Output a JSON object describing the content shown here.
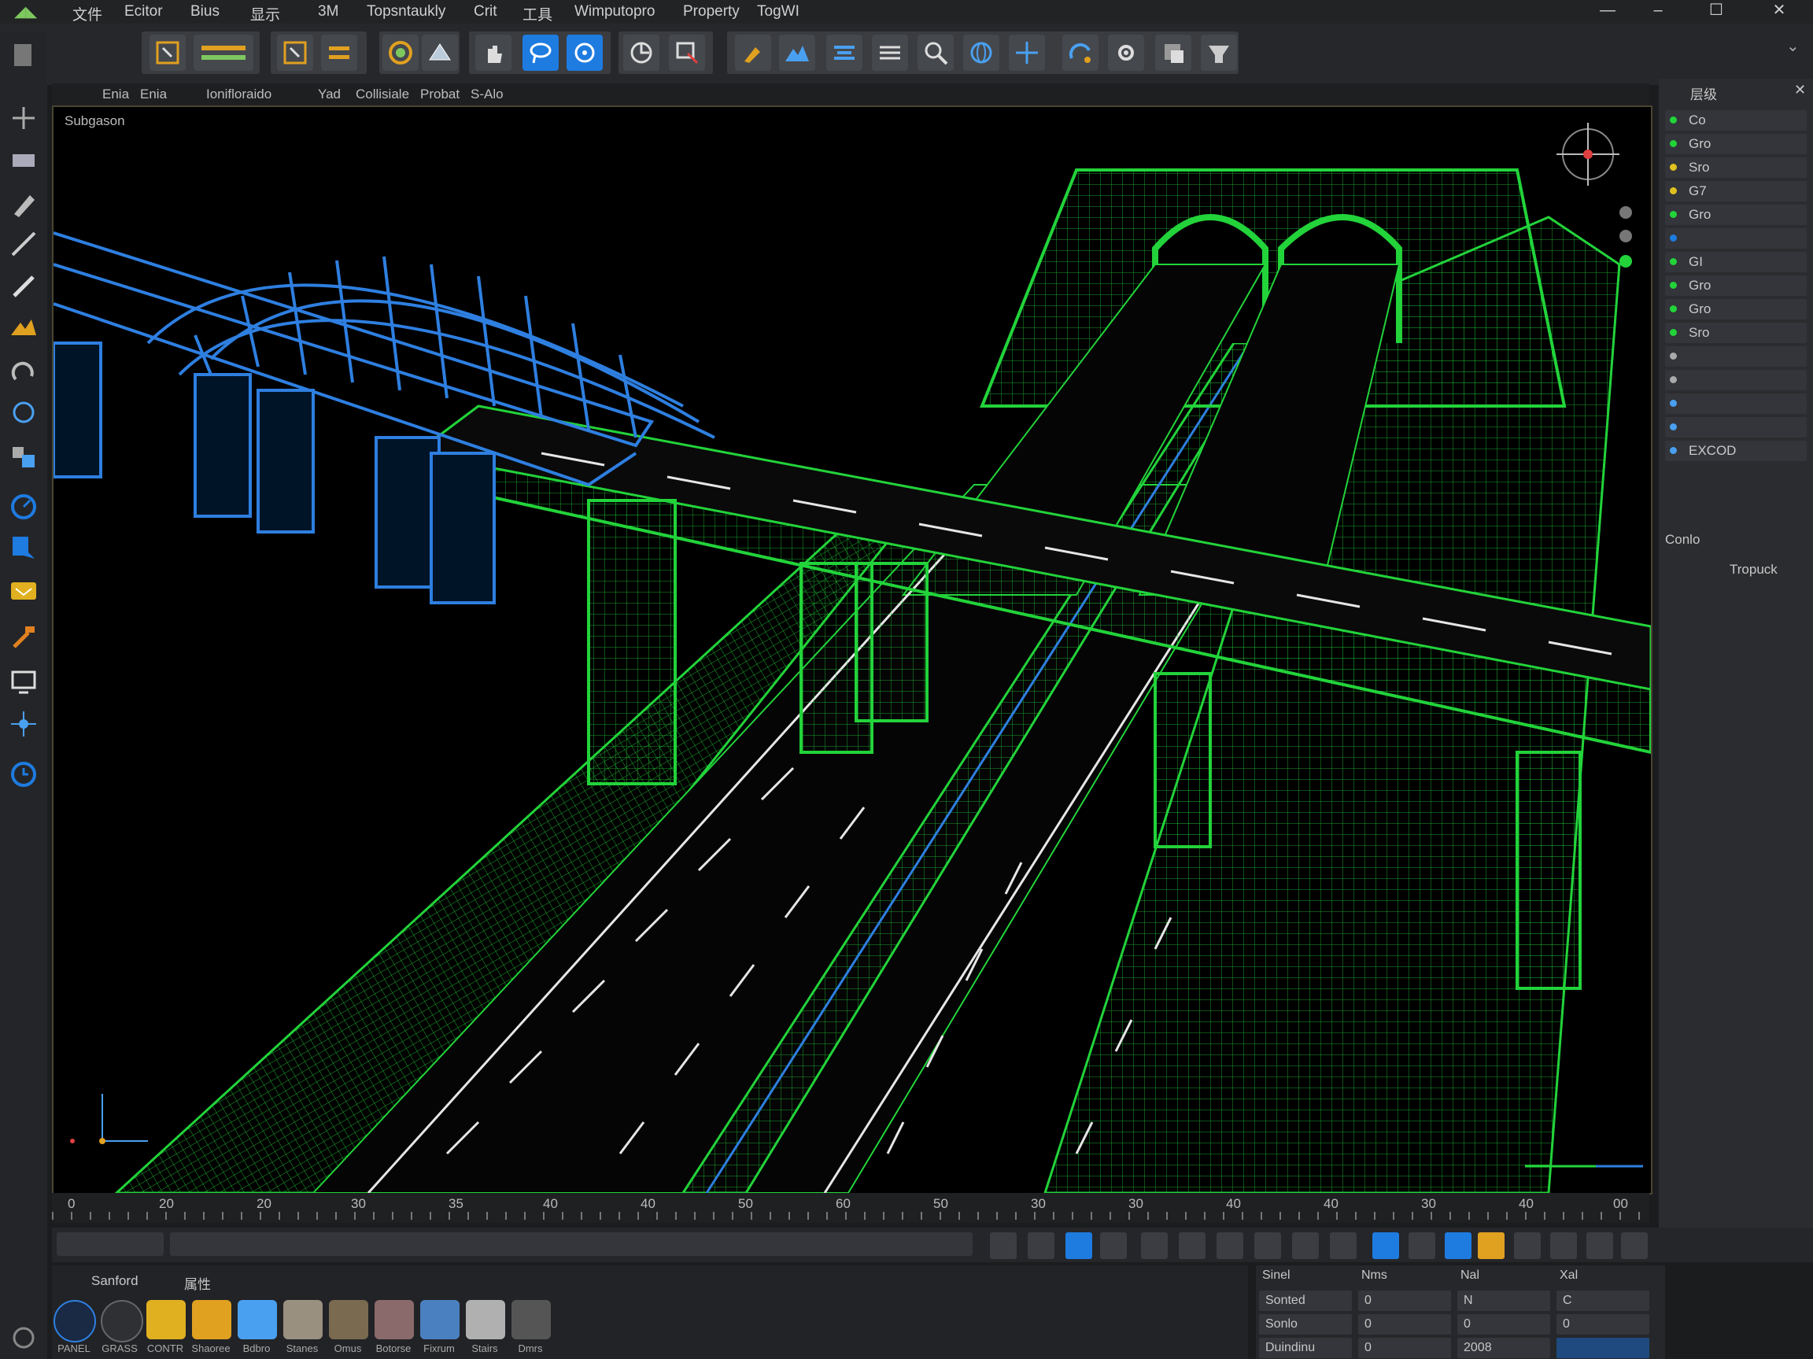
{
  "menu": {
    "items": [
      "文件",
      "Ecitor",
      "Bius",
      "显示",
      "3M",
      "Topsntaukly",
      "Crit",
      "工具",
      "Wimputopro",
      "Property",
      "TogWI"
    ]
  },
  "viewport": {
    "tabs": [
      "Enia",
      "Enia",
      "Ionifloraido",
      "Yad",
      "Collisiale",
      "Probat",
      "S-Alo"
    ],
    "label": "Subgason"
  },
  "right_panel": {
    "title": "层级",
    "rows": [
      "Co",
      "Gro",
      "Sro",
      "G7",
      "Gro",
      "",
      "GI",
      "Gro",
      "Gro",
      "Sro",
      "",
      "",
      "",
      "",
      "EXCOD"
    ],
    "section": "Conlo",
    "dropdown": "Tropuck"
  },
  "timeline": {
    "ticks": [
      "0",
      "20",
      "20",
      "30",
      "35",
      "40",
      "40",
      "50",
      "60",
      "50",
      "30",
      "30",
      "40",
      "40",
      "30",
      "40",
      "00"
    ]
  },
  "material_bar": {
    "title": "Sanford",
    "title2": "属性",
    "items": [
      "PANEL",
      "GRASS",
      "CONTR",
      "Shaoree",
      "Bdbro",
      "Stanes",
      "Omus",
      "Botorse",
      "Fixrum",
      "Stairs",
      "Dmrs"
    ]
  },
  "properties": {
    "headers": [
      "Sinel",
      "Nms",
      "Nal",
      "Xal"
    ],
    "rows": [
      [
        "Sonted",
        "0",
        "N",
        "C"
      ],
      [
        "Sonlo",
        "0",
        "0",
        "0"
      ],
      [
        "Duindinu",
        "0",
        "2008",
        ""
      ]
    ]
  },
  "colors": {
    "wire_green": "#22d33a",
    "wire_blue": "#2e7fe0",
    "accent_orange": "#e0a020",
    "accent_blue": "#1e7be0"
  }
}
